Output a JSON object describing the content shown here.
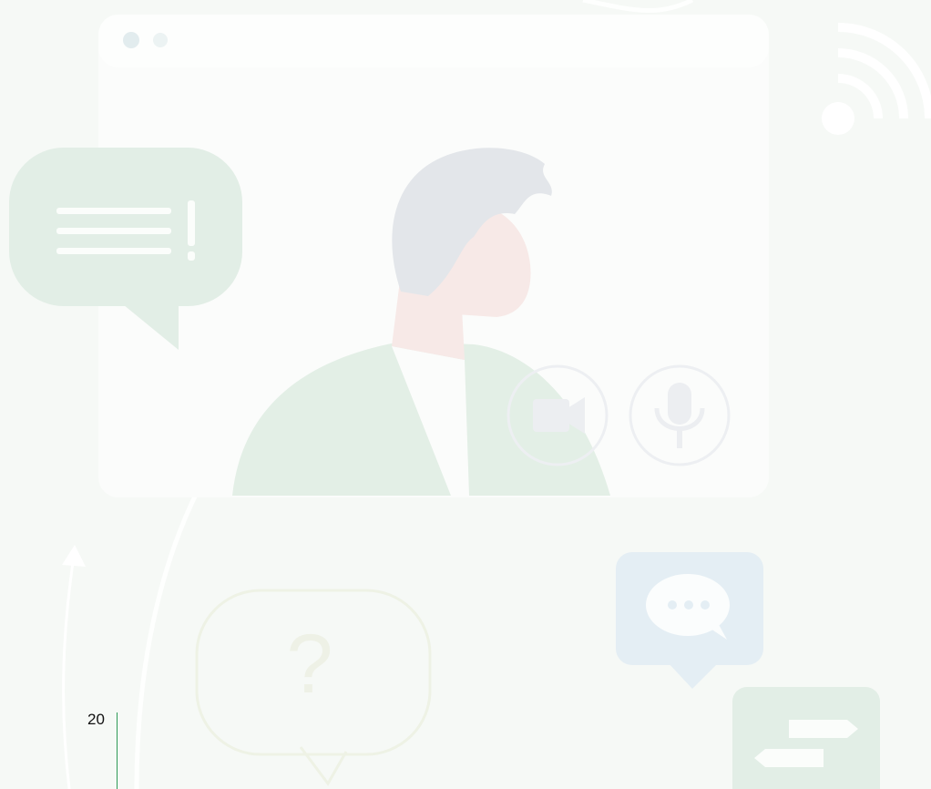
{
  "page": {
    "number": "20"
  },
  "colors": {
    "background": "#f6f9f6",
    "window": "#fbfcfb",
    "window_dot": "#e2ecee",
    "hair": "#e3e6ea",
    "skin": "#f7e9e7",
    "jacket": "#e3efe6",
    "shirt": "#fbfcfb",
    "green_bubble": "#e2eee6",
    "blue_bubble": "#e4eef4",
    "rule": "#2e9a57",
    "page_number": "#111111"
  },
  "icons": [
    "video-camera-icon",
    "microphone-icon",
    "wifi-signal-icon",
    "chat-bubble-alert-icon",
    "chat-typing-icon",
    "question-bubble-icon",
    "swap-arrows-icon",
    "up-arrow-icon"
  ]
}
